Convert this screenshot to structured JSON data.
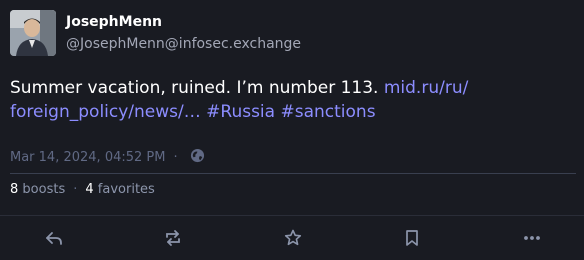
{
  "author": {
    "display_name": "JosephMenn",
    "handle": "@JosephMenn@infosec.exchange"
  },
  "post": {
    "text_plain": "Summer vacation, ruined. I’m number 113. ",
    "link_text_line1": "mid.ru/ru/",
    "link_text_line2": "foreign_policy/news/…",
    "hashtag_1": "#Russia",
    "hashtag_2": "#sanctions",
    "timestamp": "Mar 14, 2024, 04:52 PM",
    "separator": "·",
    "visibility_icon": "globe-icon"
  },
  "stats": {
    "boosts_count": "8",
    "boosts_label": "boosts",
    "favorites_count": "4",
    "favorites_label": "favorites",
    "separator": "·"
  },
  "actions": {
    "reply_icon": "reply-icon",
    "boost_icon": "boost-icon",
    "favorite_icon": "star-icon",
    "bookmark_icon": "bookmark-icon",
    "more_icon": "more-icon"
  },
  "colors": {
    "background": "#191b22",
    "text": "#ffffff",
    "secondary_text": "#a3a7b6",
    "link": "#8c8dff",
    "muted": "#606984",
    "icon": "#8c95ab"
  }
}
